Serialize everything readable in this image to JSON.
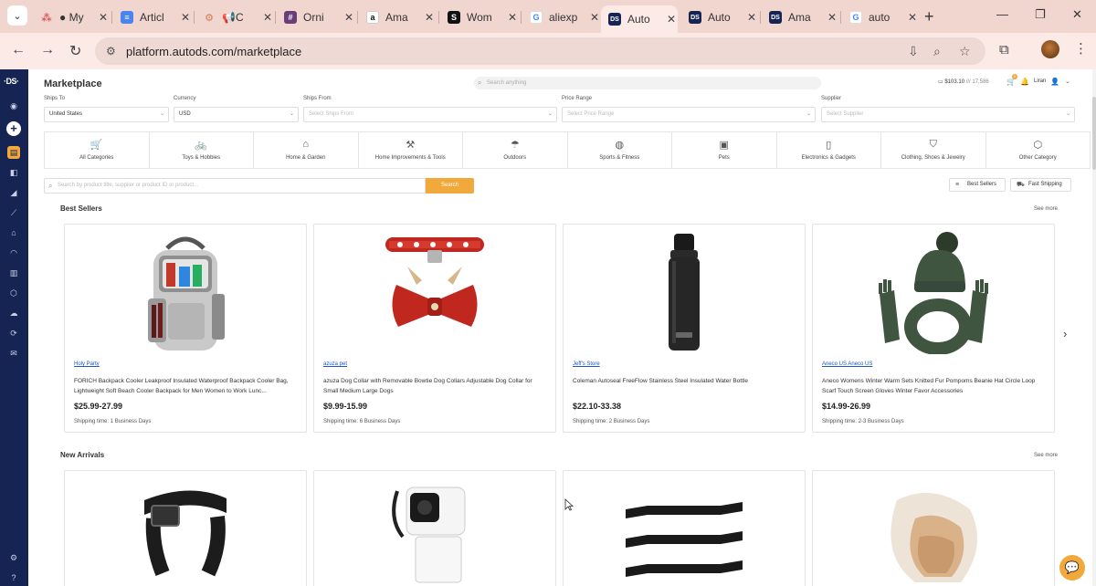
{
  "browser": {
    "tabs": [
      {
        "label": "My",
        "favicon": "asana-icon",
        "color": "#e0585a",
        "glyph": "",
        "prefix": "●"
      },
      {
        "label": "Articl",
        "favicon": "docs-icon",
        "color": "#4a84f0",
        "glyph": "≡",
        "prefix": ""
      },
      {
        "label": "C",
        "favicon": "megaphone-icon",
        "color": "#d57a50",
        "glyph": "",
        "prefix": "📢"
      },
      {
        "label": "Orni",
        "favicon": "slack-icon",
        "color": "#6b3d78",
        "glyph": "#",
        "prefix": ""
      },
      {
        "label": "Ama",
        "favicon": "amazon-icon",
        "color": "#111111",
        "glyph": "a",
        "prefix": ""
      },
      {
        "label": "Wom",
        "favicon": "s-icon",
        "color": "#111111",
        "glyph": "S",
        "prefix": ""
      },
      {
        "label": "aliexp",
        "favicon": "google-icon",
        "color": "#ffffff",
        "glyph": "G",
        "prefix": ""
      },
      {
        "label": "Auto",
        "favicon": "autods-icon",
        "color": "#152452",
        "glyph": "DS",
        "prefix": ""
      },
      {
        "label": "Auto",
        "favicon": "autods-icon",
        "color": "#152452",
        "glyph": "DS",
        "prefix": ""
      },
      {
        "label": "Ama",
        "favicon": "autods-icon",
        "color": "#152452",
        "glyph": "DS",
        "prefix": ""
      },
      {
        "label": "auto",
        "favicon": "google-icon",
        "color": "#ffffff",
        "glyph": "G",
        "prefix": ""
      }
    ],
    "active_tab_index": 7,
    "url": "platform.autods.com/marketplace"
  },
  "header": {
    "title": "Marketplace",
    "search_placeholder": "Search anything",
    "balance_primary": "$103.10",
    "balance_secondary": "/// 17,586",
    "cart_count": "0",
    "user_name": "Liran"
  },
  "filters": [
    {
      "label": "Ships To",
      "value": "United States",
      "placeholder": false
    },
    {
      "label": "Currency",
      "value": "USD",
      "placeholder": false
    },
    {
      "label": "Ships From",
      "value": "Select Ships From",
      "placeholder": true
    },
    {
      "label": "Price Range",
      "value": "Select Price Range",
      "placeholder": true
    },
    {
      "label": "Supplier",
      "value": "Select Supplier",
      "placeholder": true
    }
  ],
  "categories": [
    {
      "label": "All Categories",
      "icon": "cart-icon",
      "glyph": "🛒"
    },
    {
      "label": "Toys & Hobbies",
      "icon": "bike-icon",
      "glyph": "🚲"
    },
    {
      "label": "Home & Garden",
      "icon": "house-icon",
      "glyph": "⌂"
    },
    {
      "label": "Home Improvements & Tools",
      "icon": "tools-icon",
      "glyph": "⚒"
    },
    {
      "label": "Outdoors",
      "icon": "umbrella-icon",
      "glyph": "☂"
    },
    {
      "label": "Sports & Fitness",
      "icon": "ball-icon",
      "glyph": "◍"
    },
    {
      "label": "Pets",
      "icon": "pet-icon",
      "glyph": "▣"
    },
    {
      "label": "Electronics & Gadgets",
      "icon": "phone-icon",
      "glyph": "▯"
    },
    {
      "label": "Clothing, Shoes & Jewelry",
      "icon": "hat-icon",
      "glyph": "⛉"
    },
    {
      "label": "Other Category",
      "icon": "box-icon",
      "glyph": "⬡"
    }
  ],
  "product_search": {
    "placeholder": "Search by product title, supplier or product ID or product...",
    "button_label": "Search"
  },
  "toggles": {
    "best_sellers": "Best Sellers",
    "fast_shipping": "Fast Shipping"
  },
  "best_sellers": {
    "title": "Best Sellers",
    "see_more": "See more",
    "products": [
      {
        "store": "Holy Party",
        "name": "FORICH Backpack Cooler Leakproof Insulated Waterproof Backpack Cooler Bag, Lightweight Soft Beach Cooler Backpack for Men Women to Work Lunc...",
        "price": "$25.99-27.99",
        "shipping": "Shipping time: 1 Business Days"
      },
      {
        "store": "azuza pet",
        "name": "azuza Dog Collar with Removable Bowtie Dog Collars Adjustable Dog Collar for Small Medium Large Dogs",
        "price": "$9.99-15.99",
        "shipping": "Shipping time: 6 Business Days"
      },
      {
        "store": "Jeff's Store",
        "name": "Coleman Autoseal FreeFlow Stainless Steel Insulated Water Bottle",
        "price": "$22.10-33.38",
        "shipping": "Shipping time: 2 Business Days"
      },
      {
        "store": "Aneco US Aneco US",
        "name": "Aneco Womens Winter Warm Sets Knitted Fur Pompoms Beanie Hat Circle Loop Scarf Touch Screen Gloves Winter Favor Accessories",
        "price": "$14.99-26.99",
        "shipping": "Shipping time: 2-3 Business Days"
      }
    ]
  },
  "new_arrivals": {
    "title": "New Arrivals",
    "see_more": "See more"
  },
  "colors": {
    "accent": "#f0a93a",
    "sidebar": "#152452",
    "link": "#1e56c4"
  }
}
